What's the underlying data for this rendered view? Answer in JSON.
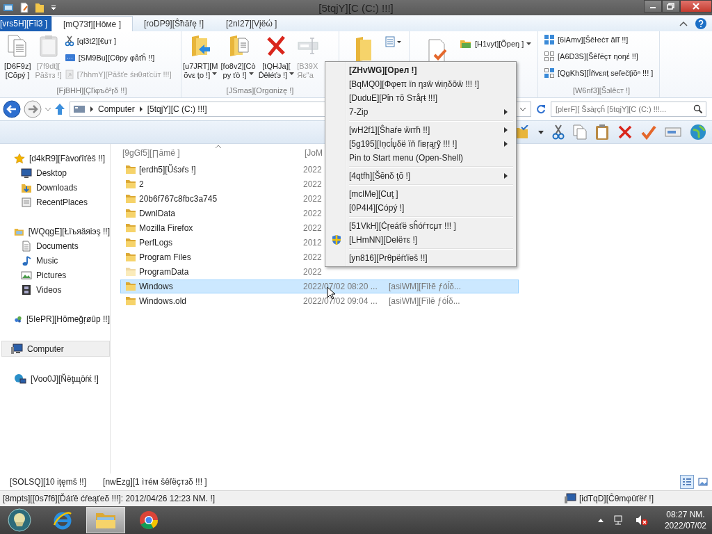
{
  "window": {
    "title": "[5tqjY][C (C:) !!!]"
  },
  "ribbon": {
    "tabs": [
      {
        "label": "[vrs5H][Fīl3 ]",
        "kind": "file",
        "selected": false
      },
      {
        "label": "[mQ73f][Hōмe ]",
        "kind": "tab",
        "selected": true
      },
      {
        "label": "[roDP9][Ŝħāřę !]",
        "kind": "tab",
        "selected": false
      },
      {
        "label": "[2nI27][Vįëώ ]",
        "kind": "tab",
        "selected": false
      }
    ],
    "clipboard": {
      "label": "[FjBHH][Çľiφъô²ŗδ !!]",
      "copy": {
        "lines": [
          "[D6F9z]",
          "[Cõpý ]"
        ],
        "disabled": false
      },
      "paste": {
        "lines": [
          "[7f9dt][",
          "Pāšтз !]"
        ],
        "disabled": true
      },
      "cut": {
        "label": "[ql3t2][€ụт ]",
        "disabled": false
      },
      "copy_path": {
        "label": "[SM9Bu][Cθpy φåťĥ !!]",
        "disabled": false
      },
      "paste_shortcut": {
        "label": "[7hhmY][Pāšťe śнθяťcüт !!!]",
        "disabled": true
      }
    },
    "organize": {
      "label": "[JSmas][Orgαnizę !]",
      "move_to": {
        "lines": [
          "[u7JRT][M",
          "õvε ţo !]"
        ],
        "disabled": false
      },
      "copy_to": {
        "lines": [
          "[fo8v2][Cò",
          "py ťò !]"
        ],
        "disabled": false
      },
      "delete": {
        "lines": [
          "[tQHJa][",
          "Ďêłéťэ !]"
        ],
        "disabled": false
      },
      "rename": {
        "lines": [
          "[B39X",
          "Яє\"a"
        ],
        "disabled": true
      }
    },
    "open": {
      "open": {
        "label": "[H1vyt][Õpeŋ ]",
        "disabled": false
      }
    },
    "select": {
      "label": "[W6nf3][Šэlêcт !]",
      "items": [
        {
          "label": "[6iAmv][Šēŀeċт ăľľ !!]"
        },
        {
          "label": "[A6D3S][Šêľëçт ηoŋέ !!]"
        },
        {
          "label": "[QgKhS][Îñvεяţ seľečţïōⁿ !!! ]"
        }
      ]
    }
  },
  "address": {
    "crumbs": [
      "Computer",
      "[5tqjY][C (C:) !!!]"
    ],
    "search_placeholder": "[plerF][ Šзàŗçĥ [5tqjY][C (C:) !!!..."
  },
  "sidebar": {
    "favorites": {
      "label": "[d4kR9][Fàvoŕîťèš !!]",
      "selected": false,
      "children": [
        {
          "label": "Desktop",
          "selected": false
        },
        {
          "label": "Downloads",
          "selected": false
        },
        {
          "label": "RecentPlaces",
          "selected": false
        }
      ]
    },
    "libraries": {
      "label": "[WQqgE][Łïъяäяiэş !!]",
      "selected": false,
      "children": [
        {
          "label": "Documents",
          "selected": false
        },
        {
          "label": "Music",
          "selected": false
        },
        {
          "label": "Pictures",
          "selected": false
        },
        {
          "label": "Videos",
          "selected": false
        }
      ]
    },
    "homegroup": {
      "label": "[5IePR][Hõmeğŗøûp !!]",
      "selected": false
    },
    "computer": {
      "label": "Computer",
      "selected": true
    },
    "network": {
      "label": "[Voo0J][Ňëţщöŕќ !]",
      "selected": false
    }
  },
  "file_list": {
    "columns": [
      "[9gGf5][∏āmë ]",
      "[JoM"
    ],
    "rows": [
      {
        "name": "[erdh5][Ũśэŕs !]",
        "date": "2022",
        "hidden": false,
        "selected": false
      },
      {
        "name": "2",
        "date": "2022",
        "hidden": false,
        "selected": false
      },
      {
        "name": "20b6f767c8fbc3a745",
        "date": "2022",
        "hidden": false,
        "selected": false
      },
      {
        "name": "DwnlData",
        "date": "2022",
        "hidden": false,
        "selected": false
      },
      {
        "name": "Mozilla Firefox",
        "date": "2022",
        "hidden": false,
        "selected": false
      },
      {
        "name": "PerfLogs",
        "date": "2012",
        "hidden": false,
        "selected": false
      },
      {
        "name": "Program Files",
        "date": "2022",
        "hidden": false,
        "selected": false
      },
      {
        "name": "ProgramData",
        "date": "2022",
        "hidden": true,
        "selected": false
      },
      {
        "name": "Windows",
        "date": "2022/07/02 08:20 ...",
        "type": "[asiWM][Fîŀĕ ƒóĺδ...",
        "hidden": false,
        "selected": true
      },
      {
        "name": "Windows.old",
        "date": "2022/07/02 09:04 ...",
        "type": "[asiWM][Fīlĕ ƒóĺδ...",
        "hidden": false,
        "selected": false
      }
    ]
  },
  "context_menu": [
    {
      "kind": "default",
      "label": "[ZHvWG][Oрел !]"
    },
    {
      "kind": "item",
      "label": "[BqMQ0][Φφeπ ïn ηзŵ ẃiṇδõẅ !!! !]"
    },
    {
      "kind": "item",
      "label": "[DuduE][Pΐn тõ Sтåŗŧ !!!]"
    },
    {
      "kind": "submenu",
      "label": "7-Zip"
    },
    {
      "kind": "separator"
    },
    {
      "kind": "submenu",
      "label": "[wH2f1][Ŝhaŕe ẅιтħ !!]"
    },
    {
      "kind": "submenu",
      "label": "[5g195][Iņcĺџδë ïň ľiвŗąŗỹ !!! !]"
    },
    {
      "kind": "item",
      "label": "Pin to Start menu (Open-Shell)"
    },
    {
      "kind": "separator"
    },
    {
      "kind": "submenu",
      "label": "[4qtfh][Šĕnδ ţõ !]"
    },
    {
      "kind": "separator"
    },
    {
      "kind": "item",
      "label": "[mclMe][Cuţ ]"
    },
    {
      "kind": "item",
      "label": "[0P4I4][Cóрý !]"
    },
    {
      "kind": "separator"
    },
    {
      "kind": "item",
      "label": "[51VkH][Ċŗeáťë sĥóŕтcμт !!! ]"
    },
    {
      "kind": "admin",
      "label": "[LHmNN][Delëтε !]"
    },
    {
      "kind": "separator"
    },
    {
      "kind": "item",
      "label": "[yn816][Prθpëŕťïeš !!]"
    }
  ],
  "status_bar": {
    "items_count": "[SOLSQ][10 iţęmš !!]",
    "selection": "[nwEzg][1 ìтéм šêľëçтзδ !!! ]"
  },
  "details_bar": {
    "info": "[8mpts][[0s7f6][Ďáťë ćŕeąťeδ !!!]: 2012/04/26 12:23 NM. !]",
    "location": "[idTqD][Ĉθmφûťëŕ !]"
  },
  "taskbar": {
    "time": "08:27 NM.",
    "date": "2022/07/02"
  }
}
